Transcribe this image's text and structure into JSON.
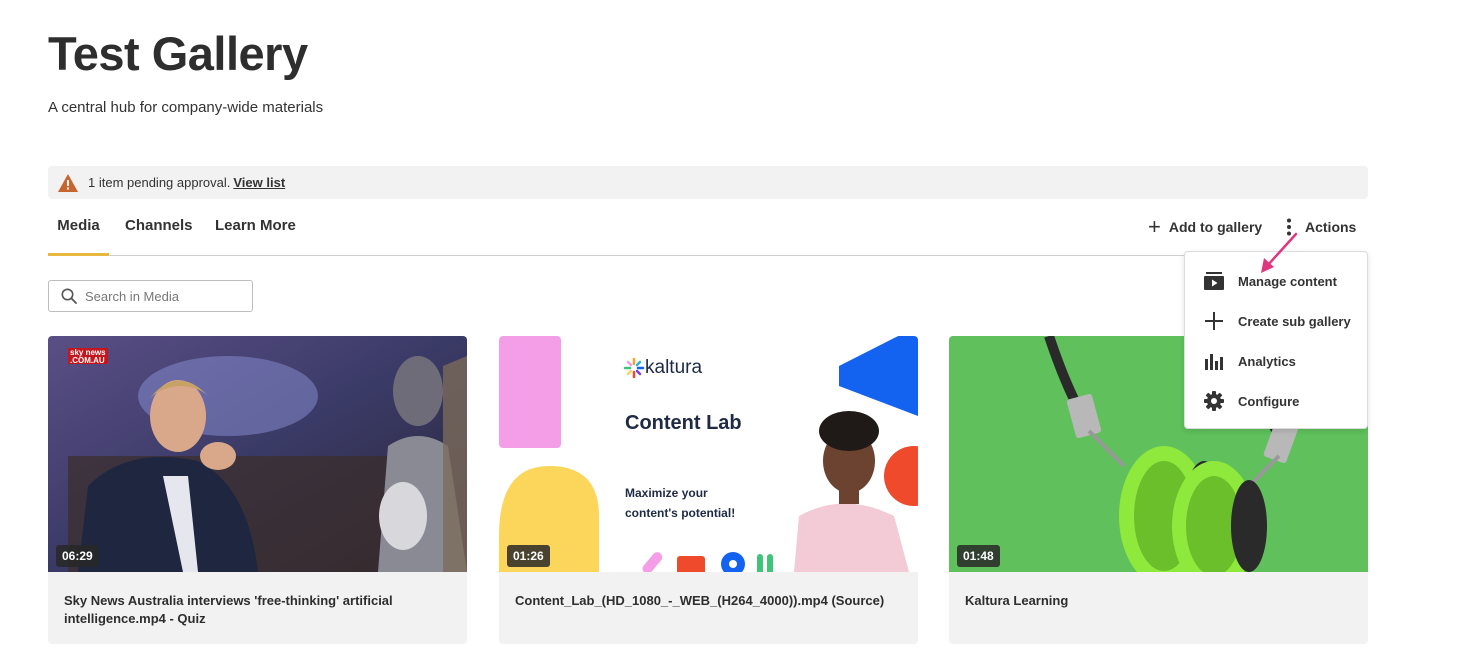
{
  "page": {
    "title": "Test Gallery",
    "subtitle": "A central hub for company-wide materials"
  },
  "alert": {
    "icon": "warning-icon",
    "text": "1 item pending approval.",
    "link": "View list",
    "icon_color": "#c8642d"
  },
  "tabs": [
    {
      "label": "Media",
      "active": true
    },
    {
      "label": "Channels",
      "active": false
    },
    {
      "label": "Learn More",
      "active": false
    }
  ],
  "toolbar": {
    "add_label": "Add to gallery",
    "actions_label": "Actions"
  },
  "search": {
    "placeholder": "Search in Media",
    "value": ""
  },
  "actions_menu": {
    "items": [
      {
        "label": "Manage content",
        "icon": "play-box-icon"
      },
      {
        "label": "Create sub gallery",
        "icon": "plus-icon"
      },
      {
        "label": "Analytics",
        "icon": "bar-chart-icon"
      },
      {
        "label": "Configure",
        "icon": "gear-icon"
      }
    ]
  },
  "media": [
    {
      "title": "Sky News Australia interviews 'free-thinking' artificial intelligence.mp4 - Quiz",
      "duration": "06:29",
      "thumb_logo": "sky news .COM.AU"
    },
    {
      "title": "Content_Lab_(HD_1080_-_WEB_(H264_4000)).mp4 (Source)",
      "duration": "01:26",
      "thumb_brand": "kaltura",
      "thumb_heading": "Content Lab",
      "thumb_tagline_1": "Maximize your",
      "thumb_tagline_2": "content's potential!"
    },
    {
      "title": "Kaltura Learning",
      "duration": "01:48"
    }
  ],
  "colors": {
    "tab_active_underline": "#e8b83f",
    "pointer_arrow": "#e0357f",
    "card_background": "#f2f2f2"
  }
}
